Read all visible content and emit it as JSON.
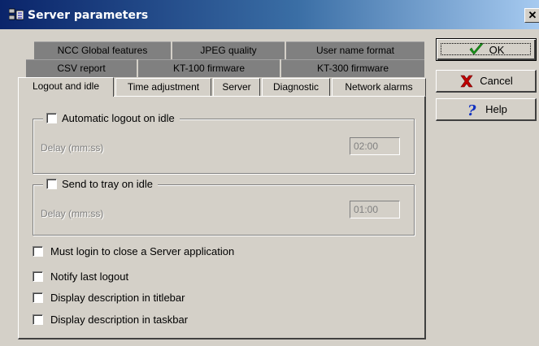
{
  "window": {
    "title": "Server parameters",
    "icon": "server-parameters-icon",
    "close_glyph": "✕"
  },
  "tabs": {
    "row1": [
      "NCC Global features",
      "JPEG quality",
      "User name format"
    ],
    "row2": [
      "CSV report",
      "KT-100 firmware",
      "KT-300 firmware"
    ],
    "row3": [
      "Logout and idle",
      "Time adjustment",
      "Server",
      "Diagnostic",
      "Network alarms"
    ],
    "active": "Logout and idle"
  },
  "logout_group": {
    "label": "Automatic logout on idle",
    "checked": false,
    "delay_label": "Delay (mm:ss)",
    "delay_value": "02:00"
  },
  "tray_group": {
    "label": "Send to tray on idle",
    "checked": false,
    "delay_label": "Delay (mm:ss)",
    "delay_value": "01:00"
  },
  "options": [
    {
      "label": "Must login to close a Server application",
      "checked": false
    },
    {
      "label": "Notify last logout",
      "checked": false
    },
    {
      "label": "Display description in titlebar",
      "checked": false
    },
    {
      "label": "Display description in taskbar",
      "checked": false
    }
  ],
  "buttons": {
    "ok": {
      "label": "OK",
      "icon": "checkmark-icon"
    },
    "cancel": {
      "label": "Cancel",
      "icon": "red-x-icon"
    },
    "help": {
      "label": "Help",
      "icon": "question-mark-icon"
    }
  },
  "colors": {
    "titlebar_start": "#0a246a",
    "titlebar_end": "#a6caf0",
    "face": "#d4d0c8",
    "ok_check": "#1a9a1a",
    "cancel_x": "#c00000",
    "help_q": "#1030c0"
  }
}
